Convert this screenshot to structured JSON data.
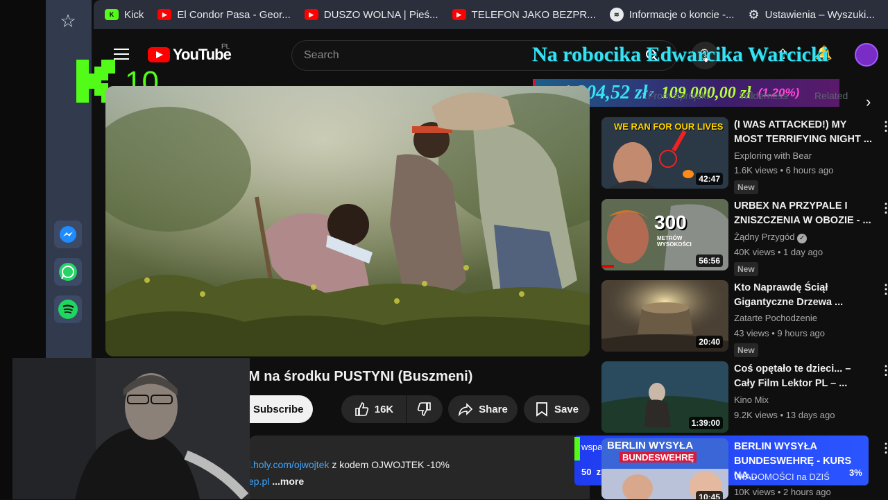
{
  "bookmarks": [
    {
      "icon": "kick-icon",
      "label": "Kick"
    },
    {
      "icon": "youtube-icon",
      "label": "El Condor Pasa - Geor..."
    },
    {
      "icon": "youtube-icon",
      "label": "DUSZO WOLNA | Pieś..."
    },
    {
      "icon": "youtube-icon",
      "label": "TELEFON JAKO BEZPR..."
    },
    {
      "icon": "spotify-icon",
      "label": "Informacje o koncie -..."
    },
    {
      "icon": "gear-icon",
      "label": "Ustawienia – Wyszuki..."
    }
  ],
  "header": {
    "brand": "YouTube",
    "region": "PL",
    "search_placeholder": "Search"
  },
  "overlay": {
    "kick_count": "10",
    "marquee": "Na robocika Edwarcika Warcicki",
    "amount_raised": "1 304,52 zł",
    "amount_sep": "z",
    "amount_goal": "109 000,00 zł",
    "percent": "(1.20%)",
    "support_label": "wsparcie na rozwój",
    "support_progress": "50  z  2000  zł",
    "support_percent": "3%"
  },
  "filter_chips": [
    "From Sprojekt",
    "Wilderness",
    "Related"
  ],
  "video": {
    "title": "M na środku PUSTYNI (Buszmeni)",
    "subscribe_label": "Subscribe",
    "likes": "16K",
    "share_label": "Share",
    "save_label": "Save",
    "desc_link": "l.holy.com/ojwojtek",
    "desc_text": " z kodem OJWOJTEK -10%",
    "desc_link2": "ep.pl",
    "more_label": " ...more"
  },
  "related": [
    {
      "title": "(I WAS ATTACKED!) MY MOST TERRIFYING NIGHT ...",
      "channel": "Exploring with Bear",
      "meta": "1.6K views • 6 hours ago",
      "duration": "42:47",
      "badge": "New",
      "thumb_text": "WE RAN FOR OUR LIVES",
      "verified": false
    },
    {
      "title": "URBEX NA PRZYPALE I ZNISZCZENIA W OBOZIE - ...",
      "channel": "Żądny Przygód",
      "meta": "40K views • 1 day ago",
      "duration": "56:56",
      "badge": "New",
      "thumb_text": "300",
      "thumb_sub": "METRÓW WYSOKOŚCI",
      "verified": true
    },
    {
      "title": "Kto Naprawdę Ściął Gigantyczne Drzewa ...",
      "channel": "Zatarte Pochodzenie",
      "meta": "43 views • 9 hours ago",
      "duration": "20:40",
      "badge": "New",
      "verified": false
    },
    {
      "title": "Coś opętało te dzieci... – Cały Film Lektor PL – ...",
      "channel": "Kino Mix",
      "meta": "9.2K views • 13 days ago",
      "duration": "1:39:00",
      "badge": "",
      "verified": false
    },
    {
      "title": "BERLIN WYSYŁA BUNDESWEHRĘ - KURS NA...",
      "channel": "WIADOMOŚCI na DZIŚ",
      "meta": "10K views • 2 hours ago",
      "duration": "10:45",
      "badge": "",
      "thumb_text": "BERLIN WYSYŁA",
      "thumb_sub": "BUNDESWEHRĘ",
      "verified": false
    }
  ],
  "colors": {
    "youtube_red": "#ff0000",
    "kick_green": "#53fc18",
    "marquee_cyan": "#36e1f4",
    "goal_green": "#b6ff3c",
    "percent_pink": "#ff49d4",
    "link_blue": "#3ea6ff"
  }
}
